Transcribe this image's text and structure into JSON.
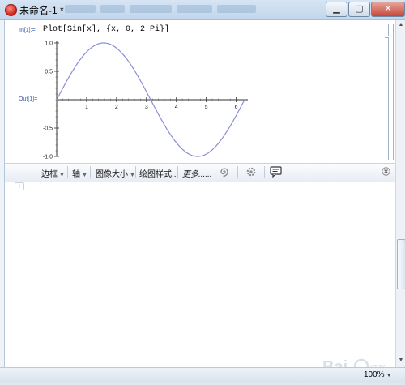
{
  "window": {
    "title": "未命名-1 *"
  },
  "notebook": {
    "input_label": "In[1]:=",
    "input_code": "Plot[Sin[x], {x, 0, 2 Pi}]",
    "output_label": "Out[1]="
  },
  "chart_data": {
    "type": "line",
    "title": "",
    "xlabel": "",
    "ylabel": "",
    "xlim": [
      0,
      6.2832
    ],
    "ylim": [
      -1.0,
      1.0
    ],
    "x_ticks": [
      "1",
      "2",
      "3",
      "4",
      "5",
      "6"
    ],
    "y_ticks": [
      "1.0",
      "0.5",
      "-0.5",
      "-1.0"
    ],
    "series": [
      {
        "function": "sin(x)",
        "color": "#8a8fd4",
        "x": [
          0,
          0.5,
          1.0,
          1.5708,
          2.0,
          2.5,
          3.1416,
          3.5,
          4.0,
          4.7124,
          5.0,
          5.5,
          6.2832
        ],
        "y": [
          0,
          0.479,
          0.841,
          1.0,
          0.909,
          0.598,
          0,
          -0.351,
          -0.757,
          -1.0,
          -0.959,
          -0.706,
          0
        ]
      }
    ]
  },
  "toolbar": {
    "items": [
      {
        "label": "边框",
        "has_dropdown": true
      },
      {
        "label": "轴",
        "has_dropdown": true
      },
      {
        "label": "图像大小",
        "has_dropdown": true
      },
      {
        "label": "绘图样式...",
        "has_dropdown": false
      },
      {
        "label": "更多......",
        "has_dropdown": false
      }
    ],
    "icons": [
      "spiral-icon",
      "gear-icon",
      "comment-icon",
      "close-icon"
    ]
  },
  "statusbar": {
    "zoom": "100%"
  }
}
